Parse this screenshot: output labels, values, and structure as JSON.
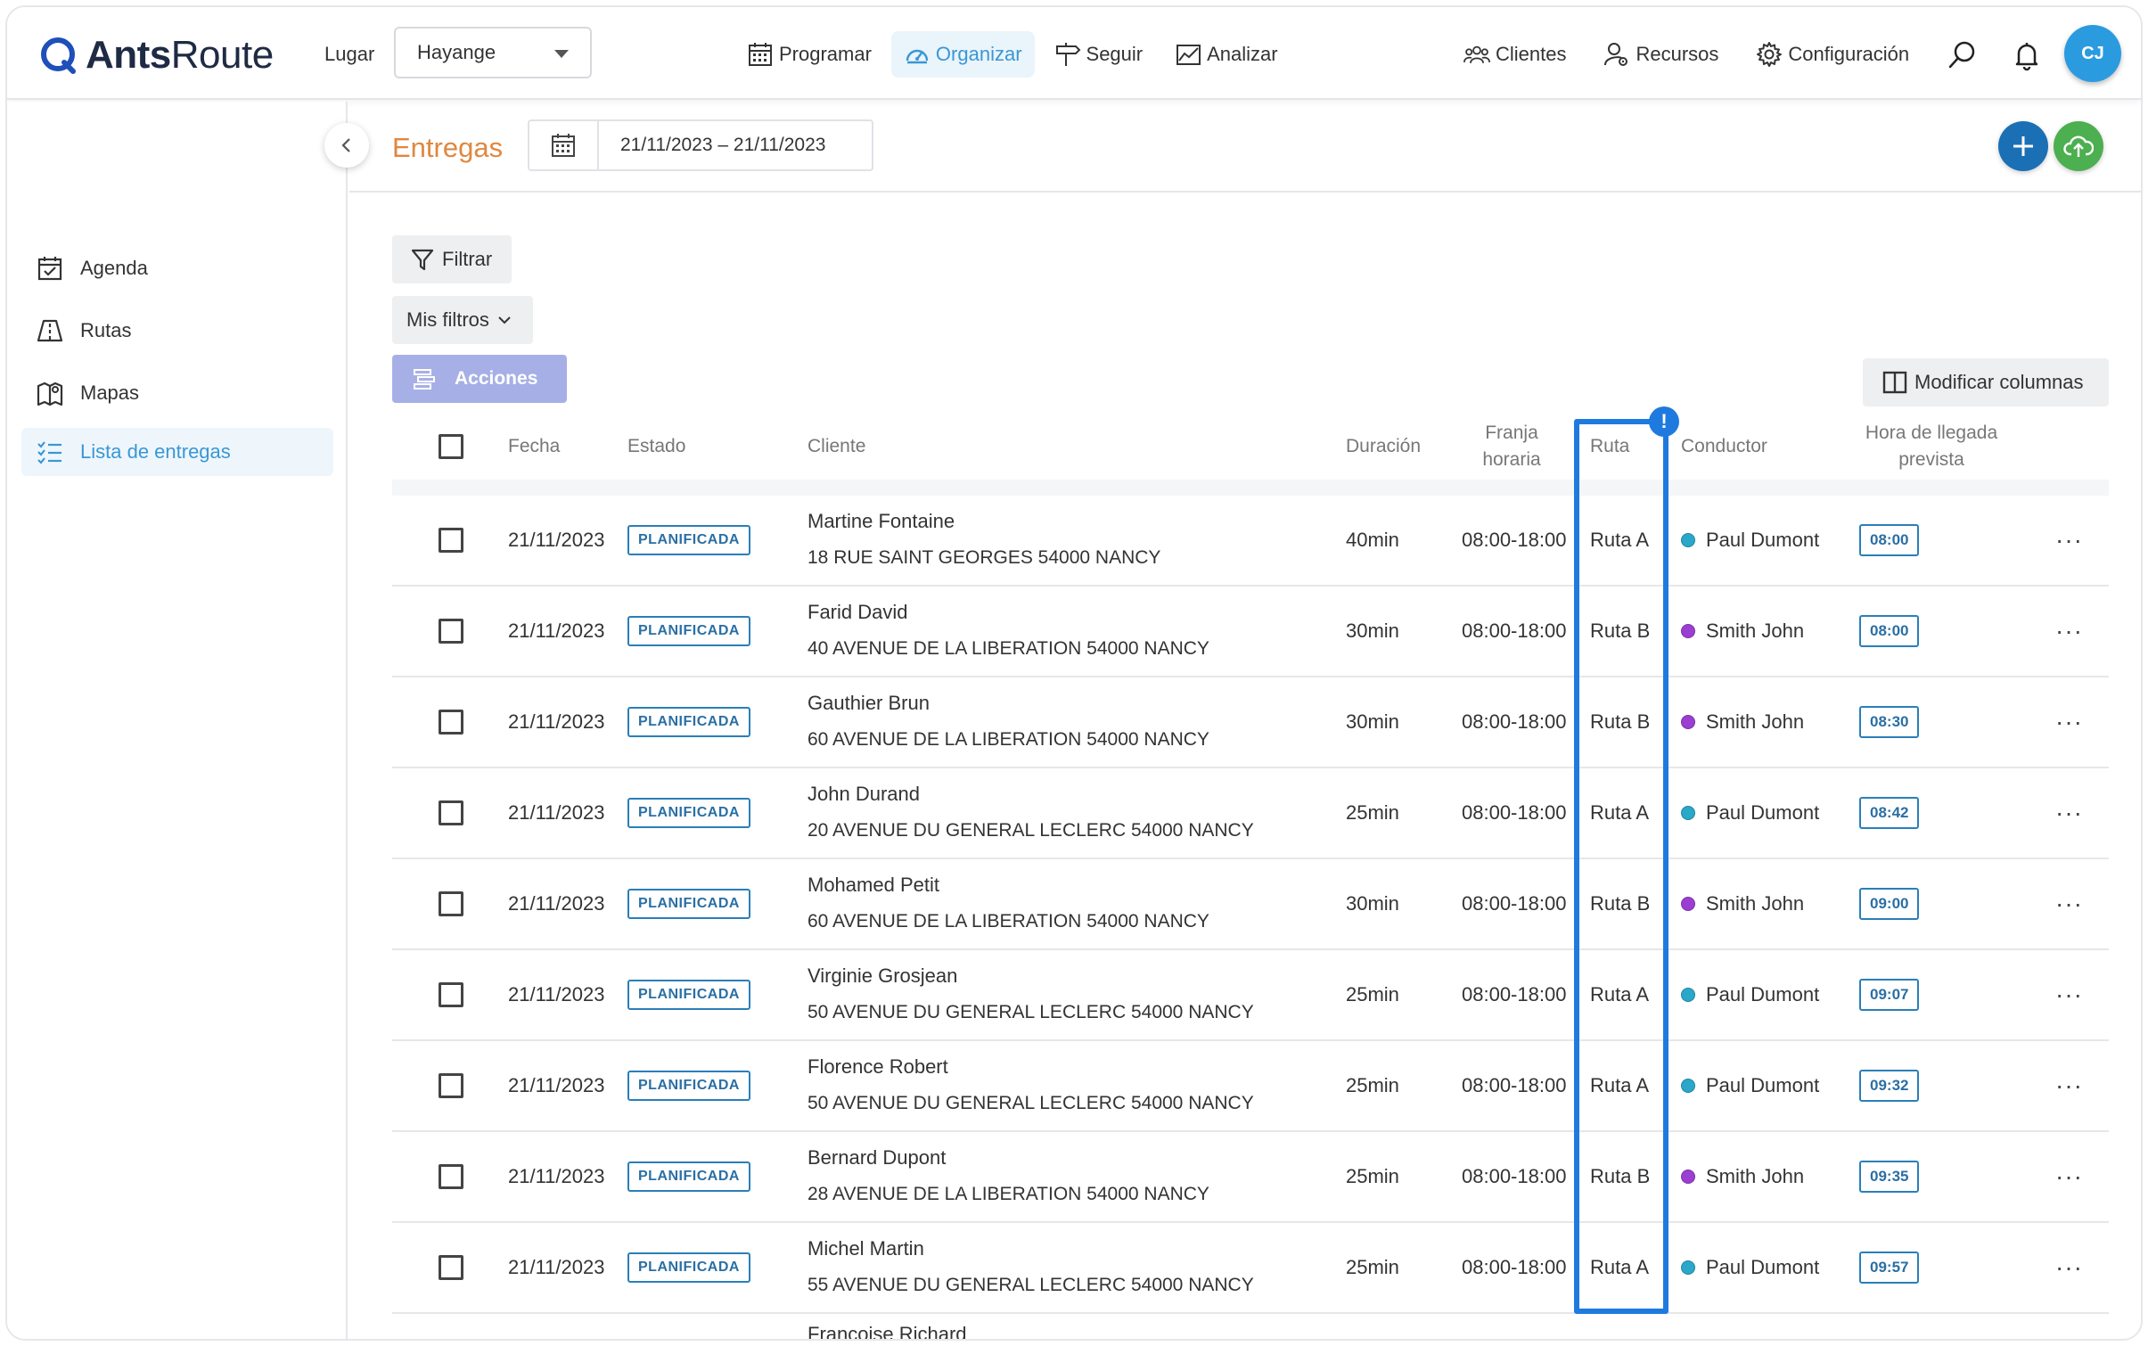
{
  "app": {
    "logo_bold": "Ants",
    "logo_light": "Route",
    "lugar_label": "Lugar",
    "lugar_value": "Hayange",
    "avatar_initials": "CJ"
  },
  "nav": {
    "programar": "Programar",
    "organizar": "Organizar",
    "seguir": "Seguir",
    "analizar": "Analizar",
    "clientes": "Clientes",
    "recursos": "Recursos",
    "configuracion": "Configuración"
  },
  "sidebar": {
    "items": [
      {
        "label": "Agenda"
      },
      {
        "label": "Rutas"
      },
      {
        "label": "Mapas"
      },
      {
        "label": "Lista de entregas"
      }
    ]
  },
  "header": {
    "title": "Entregas",
    "date_range": "21/11/2023 – 21/11/2023"
  },
  "toolbar": {
    "filtrar": "Filtrar",
    "mis_filtros": "Mis filtros",
    "acciones": "Acciones",
    "modificar_columnas": "Modificar columnas"
  },
  "table": {
    "headers": {
      "fecha": "Fecha",
      "estado": "Estado",
      "cliente": "Cliente",
      "duracion": "Duración",
      "franja_1": "Franja",
      "franja_2": "horaria",
      "ruta": "Ruta",
      "conductor": "Conductor",
      "hora_1": "Hora de llegada",
      "hora_2": "prevista"
    },
    "highlight_marker": "!",
    "rows": [
      {
        "fecha": "21/11/2023",
        "estado": "PLANIFICADA",
        "cliente": "Martine Fontaine",
        "direccion": "18 RUE SAINT GEORGES 54000 NANCY",
        "duracion": "40min",
        "franja": "08:00-18:00",
        "ruta": "Ruta A",
        "conductor": "Paul Dumont",
        "conductor_color": "#2aa7c9",
        "hora": "08:00"
      },
      {
        "fecha": "21/11/2023",
        "estado": "PLANIFICADA",
        "cliente": "Farid David",
        "direccion": "40 AVENUE DE LA LIBERATION 54000 NANCY",
        "duracion": "30min",
        "franja": "08:00-18:00",
        "ruta": "Ruta B",
        "conductor": "Smith John",
        "conductor_color": "#9a3fd1",
        "hora": "08:00"
      },
      {
        "fecha": "21/11/2023",
        "estado": "PLANIFICADA",
        "cliente": "Gauthier Brun",
        "direccion": "60 AVENUE DE LA LIBERATION 54000 NANCY",
        "duracion": "30min",
        "franja": "08:00-18:00",
        "ruta": "Ruta B",
        "conductor": "Smith John",
        "conductor_color": "#9a3fd1",
        "hora": "08:30"
      },
      {
        "fecha": "21/11/2023",
        "estado": "PLANIFICADA",
        "cliente": "John Durand",
        "direccion": "20 AVENUE DU GENERAL LECLERC 54000 NANCY",
        "duracion": "25min",
        "franja": "08:00-18:00",
        "ruta": "Ruta A",
        "conductor": "Paul Dumont",
        "conductor_color": "#2aa7c9",
        "hora": "08:42"
      },
      {
        "fecha": "21/11/2023",
        "estado": "PLANIFICADA",
        "cliente": "Mohamed Petit",
        "direccion": "60 AVENUE DE LA LIBERATION 54000 NANCY",
        "duracion": "30min",
        "franja": "08:00-18:00",
        "ruta": "Ruta B",
        "conductor": "Smith John",
        "conductor_color": "#9a3fd1",
        "hora": "09:00"
      },
      {
        "fecha": "21/11/2023",
        "estado": "PLANIFICADA",
        "cliente": "Virginie Grosjean",
        "direccion": "50 AVENUE DU GENERAL LECLERC 54000 NANCY",
        "duracion": "25min",
        "franja": "08:00-18:00",
        "ruta": "Ruta A",
        "conductor": "Paul Dumont",
        "conductor_color": "#2aa7c9",
        "hora": "09:07"
      },
      {
        "fecha": "21/11/2023",
        "estado": "PLANIFICADA",
        "cliente": "Florence Robert",
        "direccion": "50 AVENUE DU GENERAL LECLERC 54000 NANCY",
        "duracion": "25min",
        "franja": "08:00-18:00",
        "ruta": "Ruta A",
        "conductor": "Paul Dumont",
        "conductor_color": "#2aa7c9",
        "hora": "09:32"
      },
      {
        "fecha": "21/11/2023",
        "estado": "PLANIFICADA",
        "cliente": "Bernard Dupont",
        "direccion": "28 AVENUE DE LA LIBERATION 54000 NANCY",
        "duracion": "25min",
        "franja": "08:00-18:00",
        "ruta": "Ruta B",
        "conductor": "Smith John",
        "conductor_color": "#9a3fd1",
        "hora": "09:35"
      },
      {
        "fecha": "21/11/2023",
        "estado": "PLANIFICADA",
        "cliente": "Michel Martin",
        "direccion": "55 AVENUE DU GENERAL LECLERC 54000 NANCY",
        "duracion": "25min",
        "franja": "08:00-18:00",
        "ruta": "Ruta A",
        "conductor": "Paul Dumont",
        "conductor_color": "#2aa7c9",
        "hora": "09:57"
      },
      {
        "fecha": "",
        "estado": "",
        "cliente": "Françoise Richard",
        "direccion": "",
        "duracion": "",
        "franja": "",
        "ruta": "",
        "conductor": "",
        "conductor_color": "#2aa7c9",
        "hora": ""
      }
    ]
  },
  "colors": {
    "accent_orange": "#e0873e",
    "accent_blue": "#3a97d4",
    "highlight_blue": "#1f7ae0",
    "add_button": "#1b6fb5",
    "upload_button": "#4caf50"
  }
}
